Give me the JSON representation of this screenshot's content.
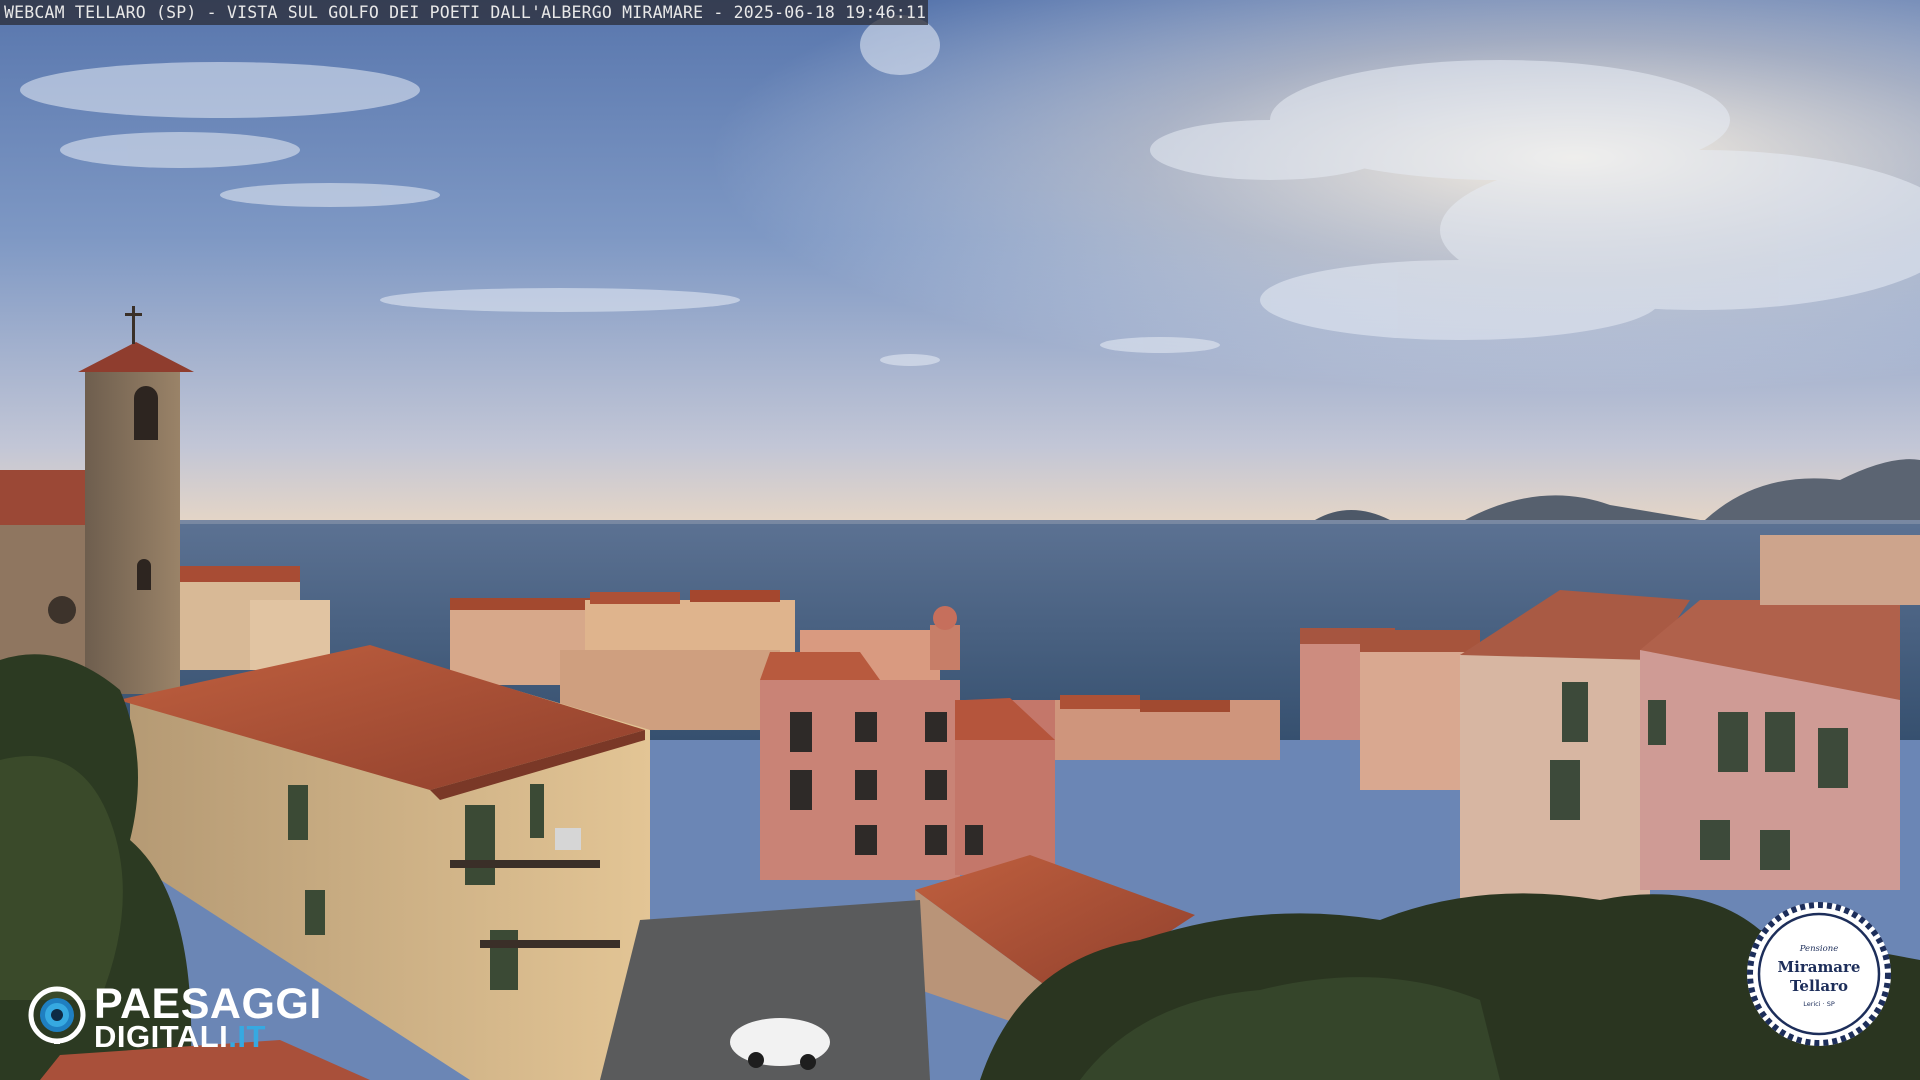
{
  "overlay": {
    "caption": "WEBCAM TELLARO (SP) - VISTA SUL GOLFO DEI POETI DALL'ALBERGO MIRAMARE - 2025-06-18 19:46:11"
  },
  "watermark_left": {
    "line1": "PAESAGGI",
    "line2_main": "DIGITALI",
    "line2_tld": ".IT",
    "icon": "camera-lens-icon"
  },
  "watermark_right": {
    "small_top": "Pensione",
    "name_line1": "Miramare",
    "name_line2": "Tellaro",
    "small_bottom": "Lerici · SP"
  },
  "colors": {
    "sky_top": "#5f7fb6",
    "sky_horizon": "#e9d9c4",
    "sea": "#3f5a7e",
    "roof": "#b4533a",
    "accent_blue": "#36a9e1",
    "seal_navy": "#1d2e5a"
  }
}
